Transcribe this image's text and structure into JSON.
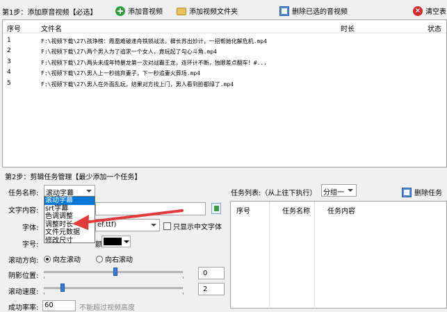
{
  "toolbar": {
    "step1_label": "第1步：添加原音视频【必选】",
    "add_media": "添加音视频",
    "add_folder": "添加视频文件夹",
    "delete_selected": "删除已选的音视频",
    "clear_list": "清空表"
  },
  "file_table": {
    "columns": [
      "序号",
      "文件名",
      "时长",
      "状态"
    ],
    "rows": [
      {
        "no": "1",
        "name": "F:\\视频下载\\27\\孩琤榜：霞凰难破逢舟铁锁战法，樨长苏出妙计，一招帮她化解危机.mp4"
      },
      {
        "no": "2",
        "name": "F:\\视频下载\\27\\两个男人为了追求一个女人，竟玩起了勾心斗角.mp4"
      },
      {
        "no": "3",
        "name": "F:\\视频下载\\27\\两头未成年特暴龙第一次对战霸王龙，连环计不断，独眼差点翻车！#..."
      },
      {
        "no": "4",
        "name": "F:\\视频下载\\27\\男人上一秒抛弃妻子，下一秒追妻火葬场.mp4"
      },
      {
        "no": "5",
        "name": "F:\\视频下载\\27\\男人在外面乱玩，结果对方找上门，男人看到脸都绿了.mp4"
      }
    ]
  },
  "step2": {
    "label": "第2步：剪辑任务管理【最少添加一个任务】",
    "task_name_label": "任务名称:",
    "task_name_value": "滚动字幕",
    "dropdown_options": [
      "滚动字幕",
      "srt字幕",
      "色调调整",
      "调整时长",
      "文件元数据",
      "修改尺寸"
    ],
    "text_content_label": "文字内容:",
    "font_label": "字体:",
    "font_value": "ef.ttf)",
    "only_chinese_font": "只显示中文字体",
    "font_size_label": "字号:",
    "color_label": "颜",
    "scroll_dir_label": "滚动方向:",
    "scroll_left": "向左滚动",
    "scroll_right": "向右滚动",
    "shadow_pos_label": "阴影位置:",
    "shadow_pos_value": "0",
    "scroll_speed_label": "滚动速度:",
    "scroll_speed_value": "2",
    "success_rate_label": "成功率率:",
    "success_rate_value": "60",
    "hint_partial": "不能超过视频高度",
    "task_list_label": "任务列表:（从上往下执行）",
    "group_value": "分组一",
    "delete_task": "删除任务",
    "task_columns": [
      "序号",
      "任务名称",
      "任务内容"
    ]
  },
  "colors": {
    "selection": "#0078d7",
    "arrow": "#e03c3c",
    "slider_thumb": "#3b7bd6"
  }
}
